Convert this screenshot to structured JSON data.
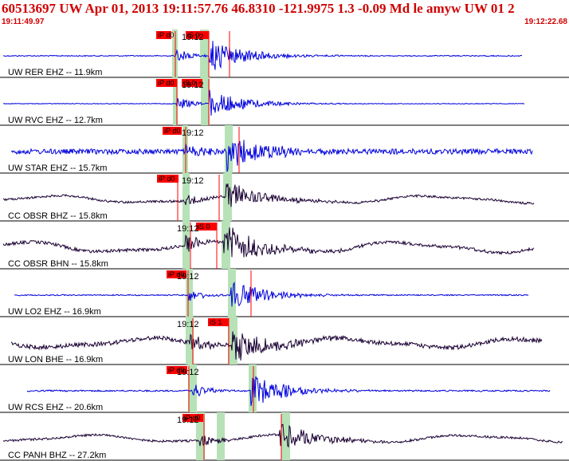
{
  "header": {
    "title": "60513697 UW Apr 01, 2013 19:11:57.76   46.8310 -121.9975  1.3 -0.09 Md le amyw UW 01   2",
    "time_start": "19:11:49.97",
    "time_end": "19:12:22.68"
  },
  "colors": {
    "header_text": "#d00000",
    "trace_blue": "#0000dd",
    "trace_dark": "#1a0033",
    "pick_bg": "#ff0000",
    "pick_line": "#ff0000",
    "window": "#b7e2b7"
  },
  "tick_label": "19:12",
  "traces": [
    {
      "label": "UW RER EHZ -- 11.9km",
      "color": "blue",
      "picks": [
        "iP d0",
        "iS 0"
      ],
      "amp": 16,
      "noise": 0.04
    },
    {
      "label": "UW RVC EHZ -- 12.7km",
      "color": "blue",
      "picks": [
        "iP d0",
        "iS 0"
      ],
      "amp": 14,
      "noise": 0.03
    },
    {
      "label": "UW STAR EHZ -- 15.7km",
      "color": "blue",
      "picks": [
        "iP d0"
      ],
      "amp": 18,
      "noise": 0.18
    },
    {
      "label": "CC OBSR BHZ -- 15.8km",
      "color": "dark",
      "picks": [
        "iP d0"
      ],
      "amp": 14,
      "noise": 0.1
    },
    {
      "label": "CC OBSR BHN -- 15.8km",
      "color": "dark",
      "picks": [
        "iS 0"
      ],
      "amp": 20,
      "noise": 0.1
    },
    {
      "label": "UW LO2 EHZ -- 16.9km",
      "color": "blue",
      "picks": [
        "iP d0"
      ],
      "amp": 14,
      "noise": 0.05
    },
    {
      "label": "UW LON BHE -- 16.9km",
      "color": "dark",
      "picks": [
        "iS 1"
      ],
      "amp": 18,
      "noise": 0.15
    },
    {
      "label": "UW RCS EHZ -- 20.6km",
      "color": "blue",
      "picks": [
        "iP d0"
      ],
      "amp": 16,
      "noise": 0.06
    },
    {
      "label": "CC PANH BHZ -- 27.2km",
      "color": "dark",
      "picks": [
        "iP d0"
      ],
      "amp": 14,
      "noise": 0.1
    }
  ]
}
